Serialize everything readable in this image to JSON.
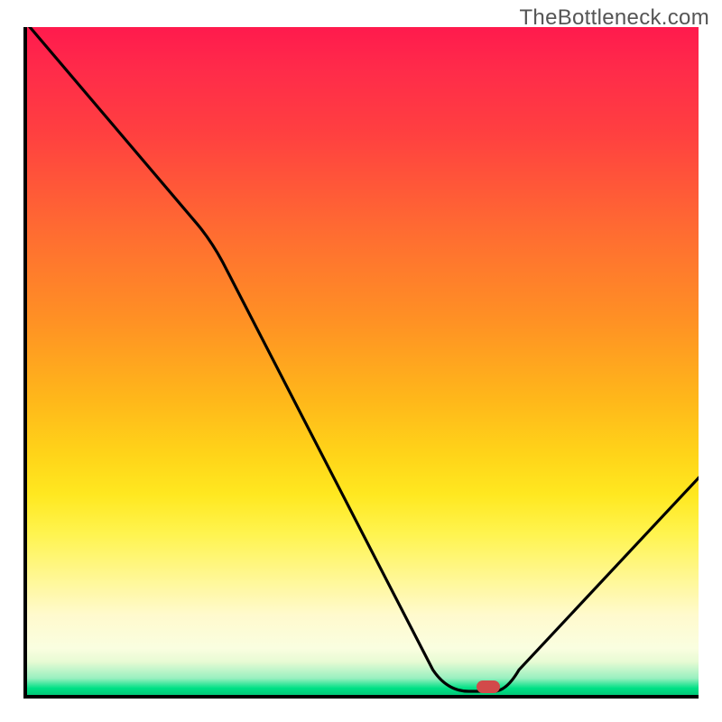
{
  "watermark": "TheBottleneck.com",
  "chart_data": {
    "type": "line",
    "title": "",
    "xlabel": "",
    "ylabel": "",
    "xlim": [
      0,
      100
    ],
    "ylim": [
      0,
      100
    ],
    "series": [
      {
        "name": "curve",
        "x": [
          0,
          25,
          62,
          66,
          70,
          100
        ],
        "y": [
          100,
          70,
          2,
          0,
          0,
          32
        ]
      }
    ],
    "marker": {
      "x": 68,
      "y": 0.5
    },
    "gradient_stops": [
      {
        "pos": 0,
        "color": "#ff1a4d"
      },
      {
        "pos": 50,
        "color": "#ffb81a"
      },
      {
        "pos": 90,
        "color": "#fffacd"
      },
      {
        "pos": 100,
        "color": "#00c878"
      }
    ]
  }
}
